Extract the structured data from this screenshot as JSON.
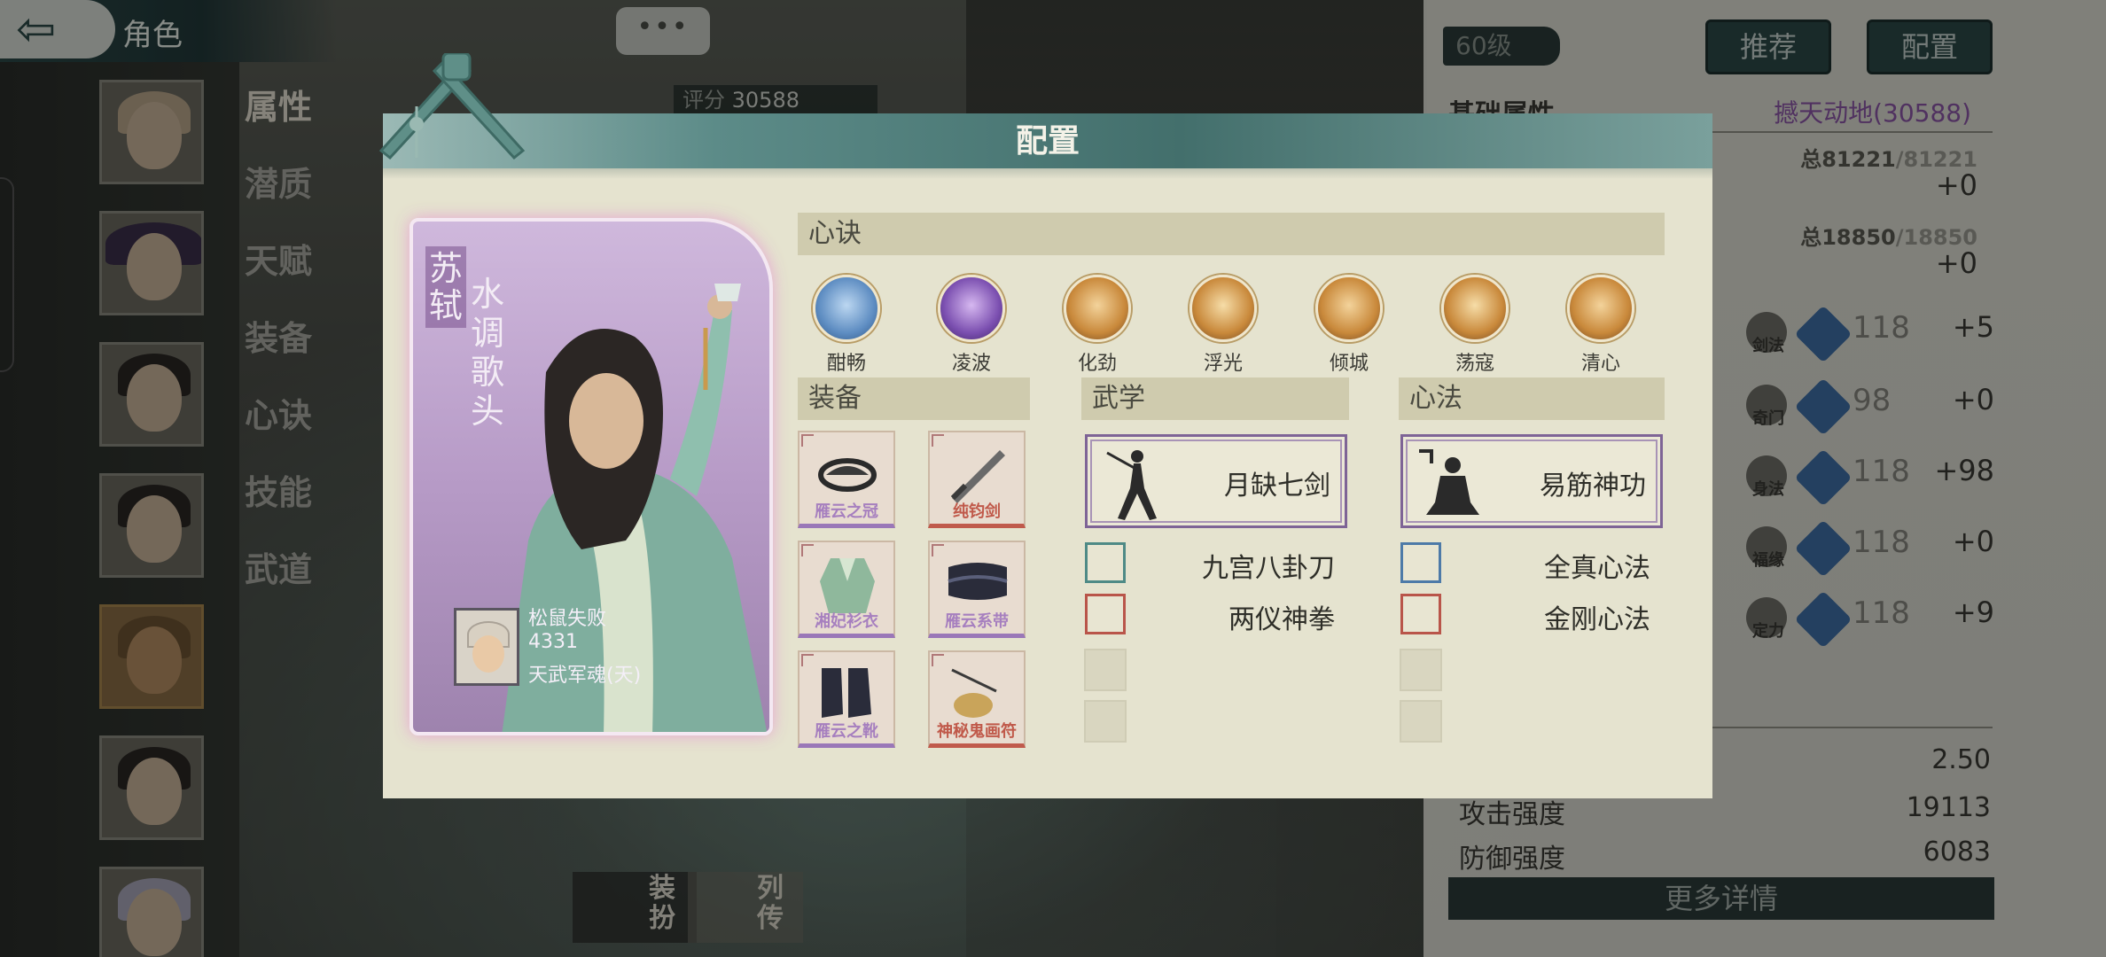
{
  "header": {
    "back_icon": "back-arrow-icon",
    "title": "角色"
  },
  "menu": {
    "items": [
      {
        "label": "属性",
        "active": true
      },
      {
        "label": "潜质",
        "active": false
      },
      {
        "label": "天赋",
        "active": false
      },
      {
        "label": "装备",
        "active": false
      },
      {
        "label": "心诀",
        "active": false
      },
      {
        "label": "技能",
        "active": false
      },
      {
        "label": "武道",
        "active": false
      }
    ]
  },
  "background": {
    "chat_bubble": "•••",
    "score_label": "评分",
    "score_value": "30588",
    "dress_label": "装扮",
    "bio_label": "列传"
  },
  "stats": {
    "level": "60级",
    "recommend_button": "推荐",
    "config_button": "配置",
    "section_label": "基础属性",
    "power": "撼天动地(30588)",
    "hp_total_prefix": "总81221",
    "hp_total_suffix": "/81221",
    "hp_plus": "+0",
    "mp_total_prefix": "总18850",
    "mp_total_suffix": "/18850",
    "mp_plus": "+0",
    "attributes": [
      {
        "label": "剑法",
        "value": "118",
        "bonus": "+5"
      },
      {
        "label": "奇门",
        "value": "98",
        "bonus": "+0"
      },
      {
        "label": "身法",
        "value": "118",
        "bonus": "+98"
      },
      {
        "label": "福缘",
        "value": "118",
        "bonus": "+0"
      },
      {
        "label": "定力",
        "value": "118",
        "bonus": "+9"
      }
    ],
    "details": [
      {
        "label": "",
        "value": "2.50"
      },
      {
        "label": "攻击强度",
        "value": "19113"
      },
      {
        "label": "防御强度",
        "value": "6083"
      }
    ],
    "more_button": "更多详情"
  },
  "dialog": {
    "title": "配置",
    "character": {
      "name": "苏轼",
      "title": "水调歌头",
      "owner_name": "松鼠失败",
      "owner_score": "4331",
      "owner_rank": "天武军魂(天)"
    },
    "xinjue_header": "心诀",
    "xinjue": [
      {
        "label": "酣畅",
        "icon": "swirl-cloud-icon",
        "color": "#5e8dc2"
      },
      {
        "label": "凌波",
        "icon": "wave-slash-icon",
        "color": "#7b4fb0"
      },
      {
        "label": "化劲",
        "icon": "palm-force-icon",
        "color": "#c9893b"
      },
      {
        "label": "浮光",
        "icon": "light-burst-icon",
        "color": "#c9893b"
      },
      {
        "label": "倾城",
        "icon": "flame-figure-icon",
        "color": "#c9893b"
      },
      {
        "label": "荡寇",
        "icon": "dragon-orb-icon",
        "color": "#c9893b"
      },
      {
        "label": "清心",
        "icon": "lotus-icon",
        "color": "#c9893b"
      }
    ],
    "equip_header": "装备",
    "equipment": [
      {
        "label": "雁云之冠",
        "icon": "crown-icon",
        "quality": "purple"
      },
      {
        "label": "纯钧剑",
        "icon": "sword-icon",
        "quality": "red"
      },
      {
        "label": "湘妃衫衣",
        "icon": "robe-icon",
        "quality": "purple"
      },
      {
        "label": "雁云系带",
        "icon": "belt-icon",
        "quality": "purple"
      },
      {
        "label": "雁云之靴",
        "icon": "boots-icon",
        "quality": "purple"
      },
      {
        "label": "神秘鬼画符",
        "icon": "talisman-icon",
        "quality": "red"
      }
    ],
    "martial_header": "武学",
    "martial_main": "月缺七剑",
    "martial_subs": [
      "九宫八卦刀",
      "两仪神拳"
    ],
    "heart_header": "心法",
    "heart_main": "易筋神功",
    "heart_subs": [
      "全真心法",
      "金刚心法"
    ]
  }
}
